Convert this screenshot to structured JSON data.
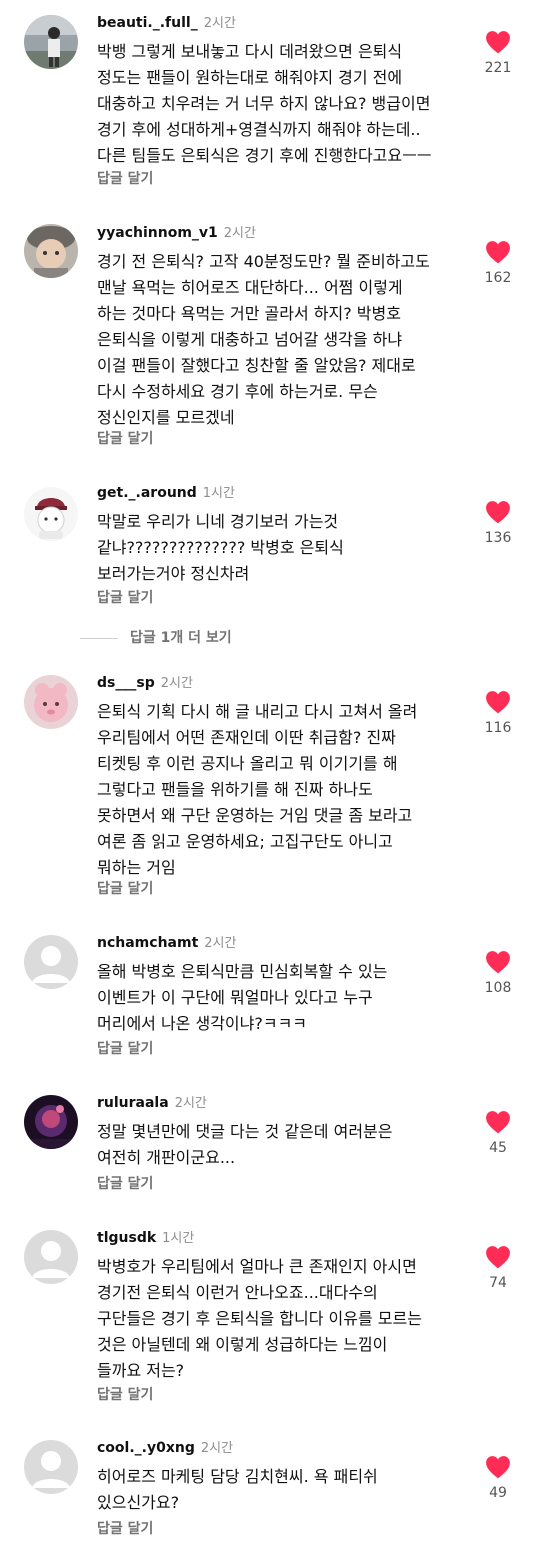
{
  "colors": {
    "heart": "#ff2d55",
    "secondary_text": "#8e8e8e",
    "reply_text": "#737373"
  },
  "comments": [
    {
      "username": "beauti._.full_",
      "time": "2시간",
      "lines": [
        "박뱅 그렇게 보내놓고 다시 데려왔으면 은퇴식",
        "정도는 팬들이 원하는대로 해줘야지 경기 전에",
        "대충하고 치우려는 거 너무 하지 않나요? 뱅급이면",
        "경기 후에 성대하게+영결식까지 해줘야 하는데..",
        "다른 팀들도 은퇴식은 경기 후에 진행한다고요ㅡㅡ"
      ],
      "likes": "221",
      "reply_label": "답글 달기",
      "avatar": "photo-person"
    },
    {
      "username": "yyachinnom_v1",
      "time": "2시간",
      "lines": [
        "경기 전 은퇴식? 고작 40분정도만? 뭘 준비하고도",
        "맨날 욕먹는 히어로즈 대단하다... 어쩜 이렇게",
        "하는 것마다 욕먹는 거만 골라서 하지? 박병호",
        "은퇴식을 이렇게 대충하고 넘어갈 생각을 하냐",
        "이걸 팬들이 잘했다고 칭찬할 줄 알았음? 제대로",
        "다시 수정하세요 경기 후에 하는거로. 무슨",
        "정신인지를 모르겠네"
      ],
      "likes": "162",
      "reply_label": "답글 달기",
      "avatar": "photo-child-hat"
    },
    {
      "username": "get._.around",
      "time": "1시간",
      "lines": [
        "막말로 우리가 니네 경기보러 가는것",
        "같냐?????????????? 박병호 은퇴식",
        "보러가는거야 정신차려"
      ],
      "likes": "136",
      "reply_label": "답글 달기",
      "avatar": "character-cap"
    },
    {
      "username": "ds___sp",
      "time": "2시간",
      "lines": [
        "은퇴식 기획 다시 해 글 내리고 다시 고쳐서 올려",
        "우리팀에서 어떤 존재인데 이딴 취급함? 진짜",
        "티켓팅 후 이런 공지나 올리고 뭐 이기기를 해",
        "그렇다고 팬들을 위하기를 해 진짜 하나도",
        "못하면서 왜 구단 운영하는 거임 댓글 좀 보라고",
        "여론 좀 읽고 운영하세요; 고집구단도 아니고",
        "뭐하는 거임"
      ],
      "likes": "116",
      "reply_label": "답글 달기",
      "avatar": "photo-pink-plush"
    },
    {
      "username": "nchamchamt",
      "time": "2시간",
      "lines": [
        "올해 박병호 은퇴식만큼 민심회복할 수 있는",
        "이벤트가 이 구단에 뭐얼마나 있다고 누구",
        "머리에서 나온 생각이냐?ㅋㅋㅋ"
      ],
      "likes": "108",
      "reply_label": "답글 달기",
      "avatar": "default-profile"
    },
    {
      "username": "ruluraala",
      "time": "2시간",
      "lines": [
        "정말 몇년만에 댓글 다는 것 같은데 여러분은",
        "여전히 개판이군요..."
      ],
      "likes": "45",
      "reply_label": "답글 달기",
      "avatar": "photo-dark-purple"
    },
    {
      "username": "tlgusdk",
      "time": "1시간",
      "lines": [
        "박병호가 우리팀에서 얼마나 큰 존재인지 아시면",
        "경기전 은퇴식 이런거 안나오죠...대다수의",
        "구단들은 경기 후 은퇴식을 합니다 이유를 모르는",
        "것은 아닐텐데 왜 이렇게 성급하다는 느낌이",
        "들까요 저는?"
      ],
      "likes": "74",
      "reply_label": "답글 달기",
      "avatar": "default-profile"
    },
    {
      "username": "cool._.y0xng",
      "time": "2시간",
      "lines": [
        "히어로즈 마케팅 담당 김치현씨. 욕 패티쉬",
        "있으신가요?"
      ],
      "likes": "49",
      "reply_label": "답글 달기",
      "avatar": "default-profile"
    }
  ],
  "more_replies_label": "답글 1개 더 보기"
}
